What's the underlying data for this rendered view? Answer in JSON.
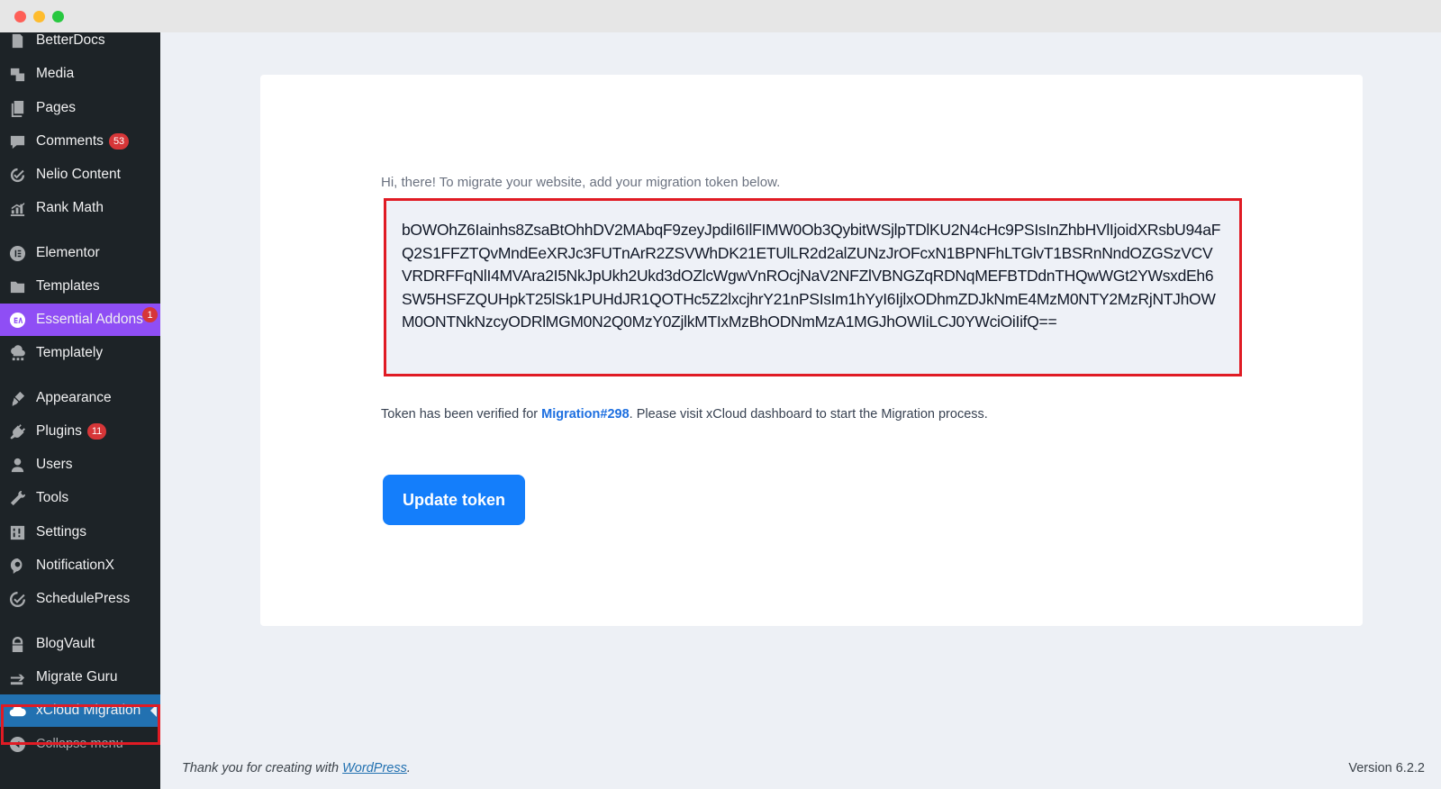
{
  "sidebar": {
    "items": [
      {
        "label": "BetterDocs",
        "icon": "docs-icon"
      },
      {
        "label": "Media",
        "icon": "media-icon"
      },
      {
        "label": "Pages",
        "icon": "pages-icon"
      },
      {
        "label": "Comments",
        "icon": "comments-icon",
        "badge": "53"
      },
      {
        "label": "Nelio Content",
        "icon": "nelio-icon"
      },
      {
        "label": "Rank Math",
        "icon": "rankmath-icon"
      },
      {
        "label": "Elementor",
        "icon": "elementor-icon"
      },
      {
        "label": "Templates",
        "icon": "folder-icon"
      },
      {
        "label": "Essential Addons",
        "icon": "essential-addons-icon",
        "badge": "1"
      },
      {
        "label": "Templately",
        "icon": "templately-icon"
      },
      {
        "label": "Appearance",
        "icon": "paintbrush-icon"
      },
      {
        "label": "Plugins",
        "icon": "plug-icon",
        "badge": "11"
      },
      {
        "label": "Users",
        "icon": "user-icon"
      },
      {
        "label": "Tools",
        "icon": "wrench-icon"
      },
      {
        "label": "Settings",
        "icon": "settings-icon"
      },
      {
        "label": "NotificationX",
        "icon": "notificationx-icon"
      },
      {
        "label": "SchedulePress",
        "icon": "schedule-icon"
      },
      {
        "label": "BlogVault",
        "icon": "blogvault-icon"
      },
      {
        "label": "Migrate Guru",
        "icon": "migrate-guru-icon"
      },
      {
        "label": "xCloud Migration",
        "icon": "cloud-icon"
      },
      {
        "label": "Collapse menu",
        "icon": "collapse-icon"
      }
    ]
  },
  "main": {
    "intro": "Hi, there! To migrate your website, add your migration token below.",
    "token": "bOWOhZ6Iainhs8ZsaBtOhhDV2MAbqF9zeyJpdiI6IlFIMW0Ob3QybitWSjlpTDlKU2N4cHc9PSIsInZhbHVlIjoidXRsbU94aFQ2S1FFZTQvMndEeXRJc3FUTnArR2ZSVWhDK21ETUlLR2d2alZUNzJrOFcxN1BPNFhLTGlvT1BSRnNndOZGSzVCVVRDRFFqNlI4MVAra2I5NkJpUkh2Ukd3dOZlcWgwVnROcjNaV2NFZlVBNGZqRDNqMEFBTDdnTHQwWGt2YWsxdEh6SW5HSFZQUHpkT25lSk1PUHdJR1QOTHc5Z2lxcjhrY21nPSIsIm1hYyI6IjlxODhmZDJkNmE4MzM0NTY2MzRjNTJhOWM0ONTNkNzcyODRlMGM0N2Q0MzY0ZjlkMTIxMzBhODNmMzA1MGJhOWIiLCJ0YWciOiIifQ==",
    "verified_prefix": "Token has been verified for ",
    "verified_link": "Migration#298",
    "verified_suffix": ". Please visit xCloud dashboard to start the Migration process.",
    "button": "Update token"
  },
  "footer": {
    "thanks_prefix": "Thank you for creating with ",
    "thanks_link": "WordPress",
    "thanks_suffix": ".",
    "version": "Version 6.2.2"
  },
  "colors": {
    "sidebar_bg": "#1d2327",
    "essential_addons_bg": "#8f4ef5",
    "current_bg": "#2271b1",
    "button_bg": "#147efb",
    "highlight_border": "#e01b24",
    "link": "#1d6fe0"
  }
}
